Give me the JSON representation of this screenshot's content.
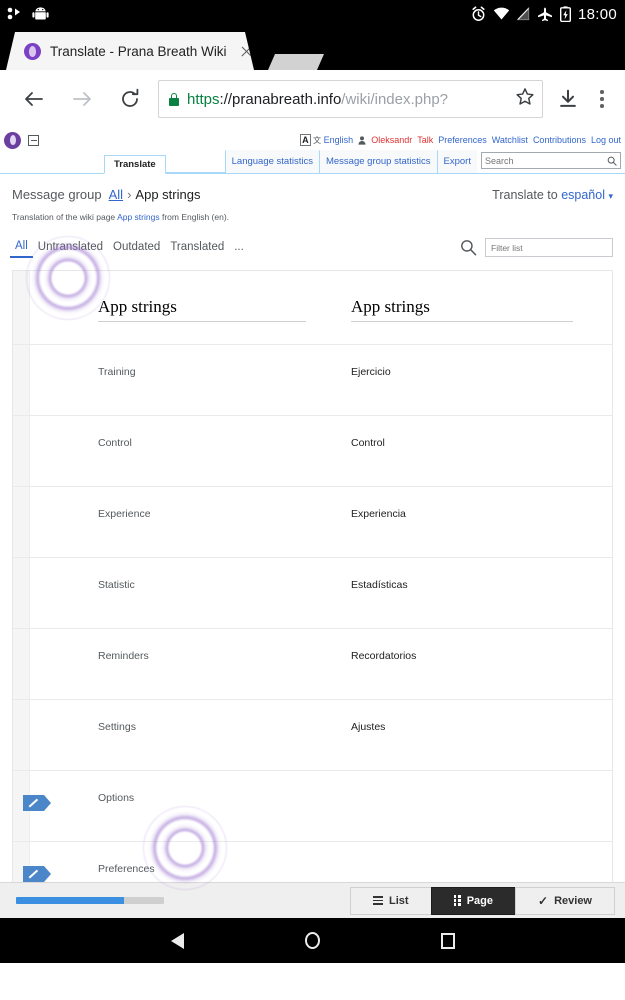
{
  "status_bar": {
    "clock": "18:00",
    "icons": [
      "alarm-icon",
      "wifi-icon",
      "signal-icon",
      "airplane-mode-icon",
      "battery-charging-icon"
    ]
  },
  "browser": {
    "tab": {
      "title": "Translate - Prana Breath Wiki",
      "favicon": "prana-breath-favicon",
      "close": "×"
    },
    "toolbar": {
      "back": "back-arrow",
      "forward": "forward-arrow",
      "reload": "reload-icon",
      "url_scheme": "https",
      "url_scheme_sep": "://",
      "url_host": "pranabreath.info",
      "url_path": "/wiki/index.php?",
      "bookmark": "star-icon",
      "download": "download-icon",
      "menu": "kebab-menu"
    }
  },
  "wiki": {
    "userbar": {
      "language": "English",
      "username": "Oleksandr",
      "links": [
        "Talk",
        "Preferences",
        "Watchlist",
        "Contributions",
        "Log out"
      ]
    },
    "navtabs": {
      "active": "Translate",
      "right_links": [
        "Language statistics",
        "Message group statistics",
        "Export"
      ],
      "search_placeholder": "Search"
    },
    "message_group": {
      "label": "Message group",
      "all": "All",
      "separator": "›",
      "name": "App strings",
      "translate_to_label": "Translate to",
      "translate_to_language": "español",
      "caret": "▾"
    },
    "description": {
      "prefix": "Translation of the wiki page ",
      "link": "App strings",
      "suffix": " from English (en)."
    },
    "filters": {
      "tabs": [
        "All",
        "Untranslated",
        "Outdated",
        "Translated"
      ],
      "active": "All",
      "more": "...",
      "search_icon": "search-icon",
      "filter_placeholder": "Filter list"
    },
    "table": {
      "headers": [
        "App strings",
        "App strings"
      ],
      "rows": [
        {
          "source": "Training",
          "target": "Ejercicio",
          "edit": false
        },
        {
          "source": "Control",
          "target": "Control",
          "edit": false
        },
        {
          "source": "Experience",
          "target": "Experiencia",
          "edit": false
        },
        {
          "source": "Statistic",
          "target": "Estadísticas",
          "edit": false
        },
        {
          "source": "Reminders",
          "target": "Recordatorios",
          "edit": false
        },
        {
          "source": "Settings",
          "target": "Ajustes",
          "edit": false
        },
        {
          "source": "Options",
          "target": "",
          "edit": true
        },
        {
          "source": "Preferences",
          "target": "",
          "edit": true
        }
      ]
    }
  },
  "app_bar": {
    "progress_percent": 73,
    "buttons": [
      {
        "label": "List",
        "icon": "list-icon",
        "active": false
      },
      {
        "label": "Page",
        "icon": "grid-icon",
        "active": true
      },
      {
        "label": "Review",
        "icon": "check-icon",
        "active": false
      }
    ]
  },
  "android_nav": {
    "back": "back-triangle",
    "home": "home-circle",
    "recents": "recents-square"
  },
  "colors": {
    "accent_blue": "#3366cc",
    "link_red": "#d33",
    "progress_blue": "#3b8fe0",
    "edit_tag_blue": "#4a86c8",
    "ripple_purple": "#966ecd"
  }
}
